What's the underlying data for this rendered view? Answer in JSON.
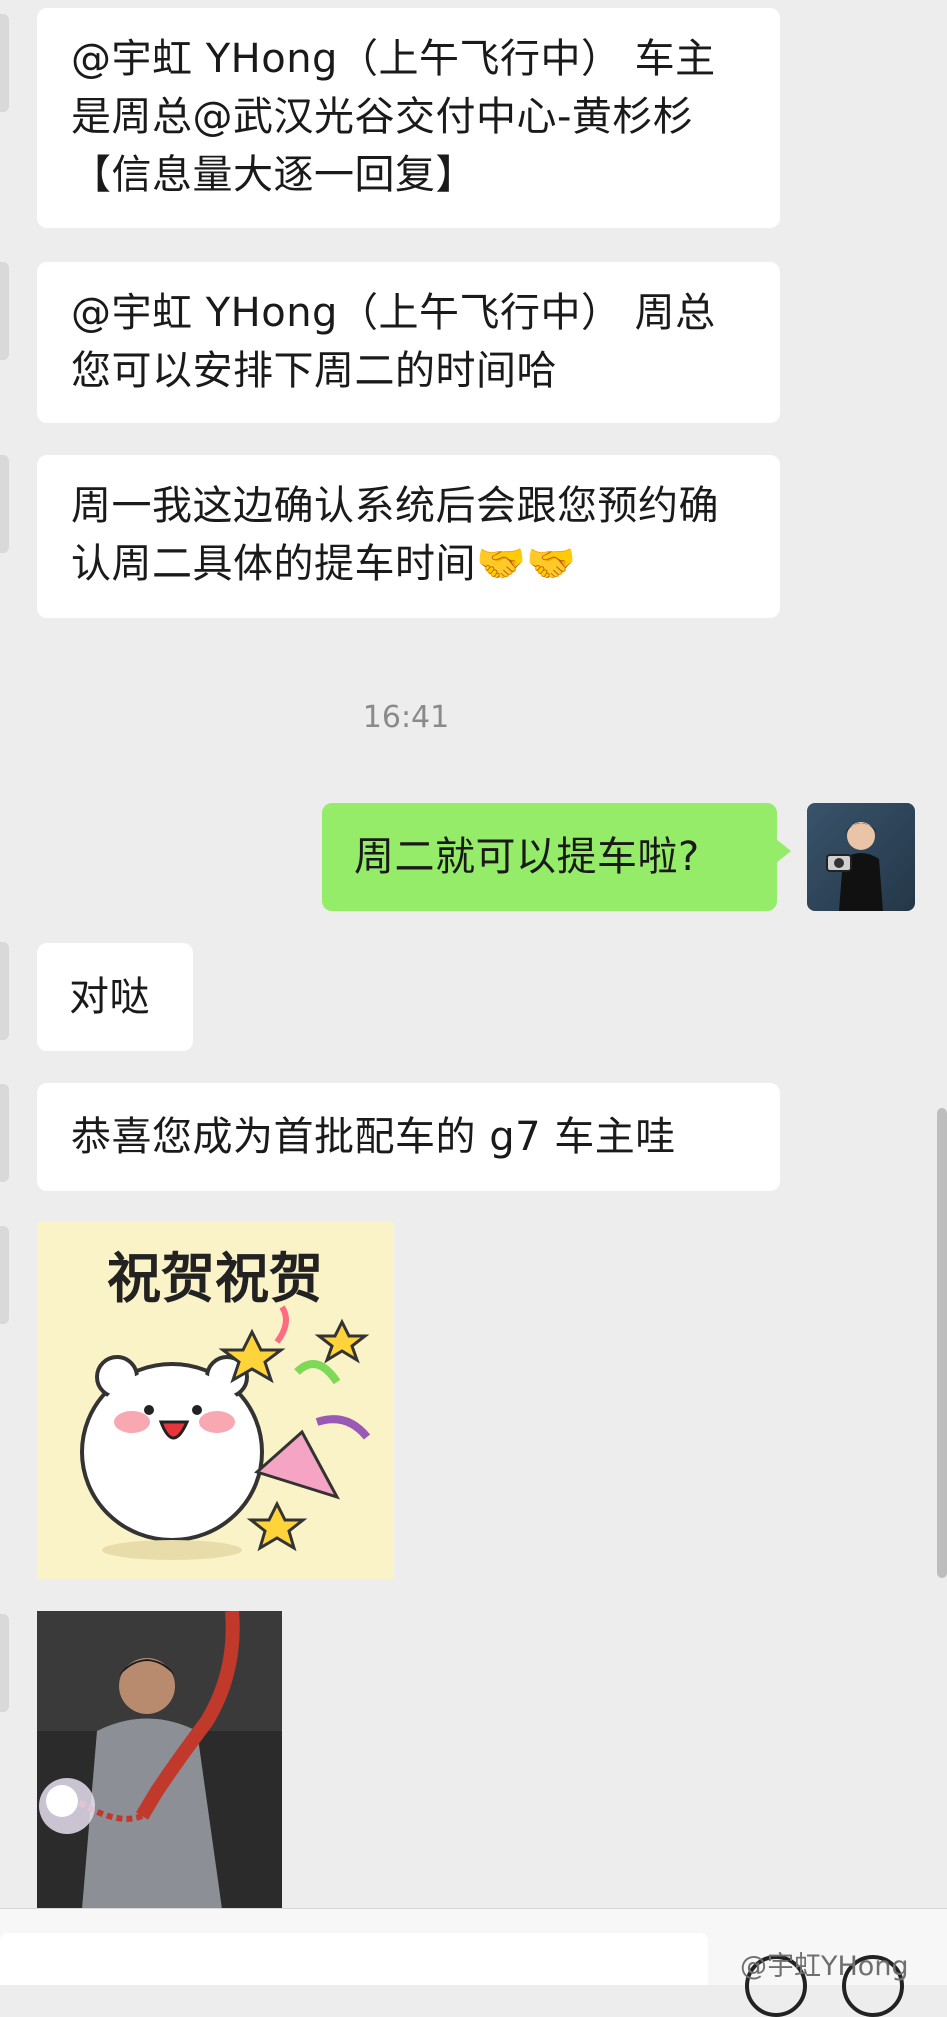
{
  "messages": [
    {
      "side": "left",
      "text": "@宇虹 YHong（上午飞行中） 车主是周总@武汉光谷交付中心-黄杉杉【信息量大逐一回复】"
    },
    {
      "side": "left",
      "text": "@宇虹 YHong（上午飞行中） 周总您可以安排下周二的时间哈"
    },
    {
      "side": "left",
      "text": "周一我这边确认系统后会跟您预约确认周二具体的提车时间🤝🤝"
    },
    {
      "side": "right",
      "text": "周二就可以提车啦?"
    },
    {
      "side": "left",
      "text": "对哒"
    },
    {
      "side": "left",
      "text": "恭喜您成为首批配车的 g7 车主哇"
    }
  ],
  "timestamp": "16:41",
  "sticker": {
    "caption": "祝贺祝贺",
    "icon": "celebration-bear-sticker"
  },
  "gif": {
    "icon": "firecracker-gif"
  },
  "input_bar": {
    "emoji_icon": "emoji-icon",
    "more_icon": "plus-icon"
  },
  "watermark": "@宇虹YHong",
  "colors": {
    "background": "#ededed",
    "received_bubble": "#ffffff",
    "sent_bubble": "#95ec69",
    "timestamp": "#8a8a8a"
  }
}
